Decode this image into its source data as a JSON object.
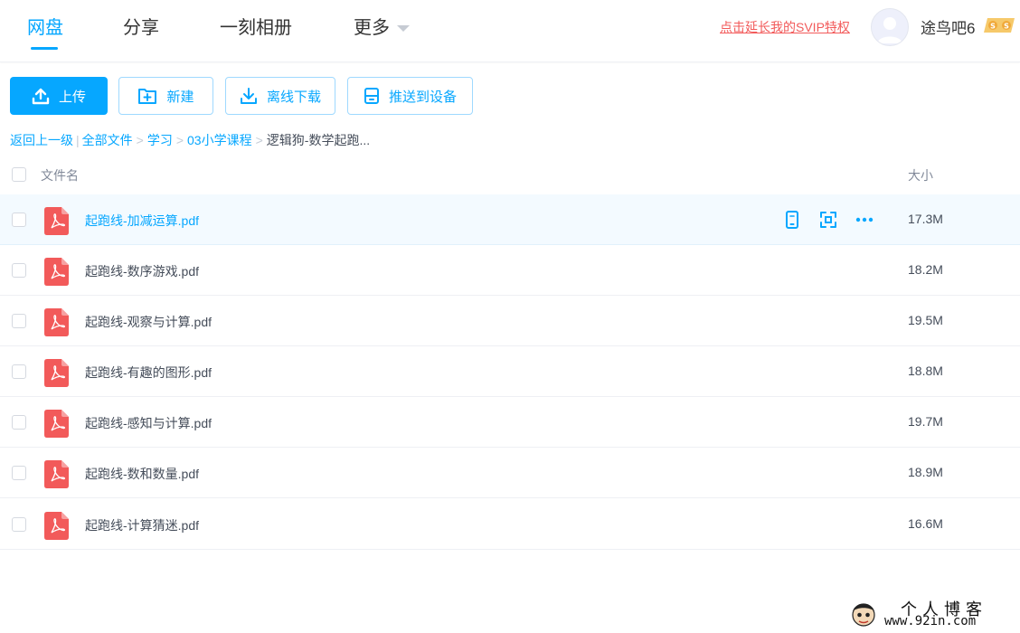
{
  "nav": {
    "tabs": [
      {
        "label": "网盘",
        "active": true
      },
      {
        "label": "分享"
      },
      {
        "label": "一刻相册"
      },
      {
        "label": "更多"
      }
    ]
  },
  "account": {
    "svip_link": "点击延长我的SVIP特权",
    "username": "途鸟吧6",
    "avatar_icon": "avatar-icon",
    "badge_icon": "svip-coin-badge-icon"
  },
  "toolbar": {
    "upload": "上传",
    "new": "新建",
    "offline_download": "离线下载",
    "push_to_device": "推送到设备"
  },
  "breadcrumb": {
    "back": "返回上一级",
    "all_files": "全部文件",
    "items": [
      "学习",
      "03小学课程"
    ],
    "current": "逻辑狗-数学起跑..."
  },
  "table": {
    "columns": {
      "name": "文件名",
      "size": "大小"
    },
    "rows": [
      {
        "name": "起跑线-加减运算.pdf",
        "size": "17.3M",
        "hover": true
      },
      {
        "name": "起跑线-数序游戏.pdf",
        "size": "18.2M"
      },
      {
        "name": "起跑线-观察与计算.pdf",
        "size": "19.5M"
      },
      {
        "name": "起跑线-有趣的图形.pdf",
        "size": "18.8M"
      },
      {
        "name": "起跑线-感知与计算.pdf",
        "size": "19.7M"
      },
      {
        "name": "起跑线-数和数量.pdf",
        "size": "18.9M"
      },
      {
        "name": "起跑线-计算猜迷.pdf",
        "size": "16.6M"
      }
    ],
    "row_actions": [
      "phone-icon",
      "share-icon",
      "more-icon"
    ]
  },
  "watermark": {
    "title": "个人博客",
    "url": "www.92in.com"
  },
  "colors": {
    "accent": "#06a7ff",
    "svip": "#f25a5a",
    "pdf": "#f25a5a",
    "hover_row": "#f3faff"
  }
}
